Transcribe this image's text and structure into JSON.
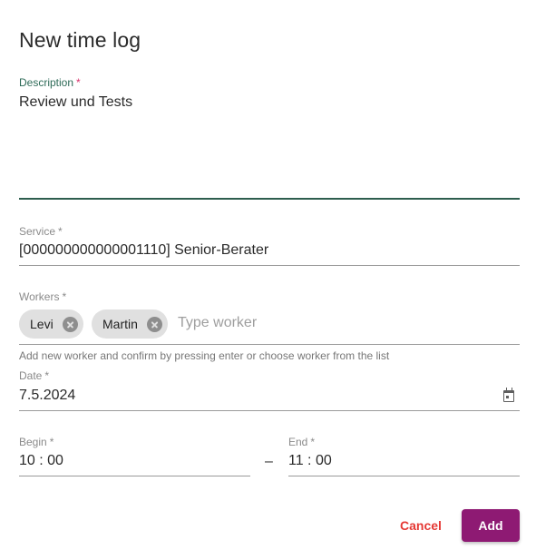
{
  "dialog": {
    "title": "New time log"
  },
  "description": {
    "label": "Description",
    "required_mark": "*",
    "value": "Review und Tests"
  },
  "service": {
    "label": "Service",
    "required_mark": "*",
    "value": "[000000000000001110] Senior-Berater"
  },
  "workers": {
    "label": "Workers",
    "required_mark": "*",
    "chips": [
      {
        "label": "Levi",
        "remove_icon": "cancel-circle-icon"
      },
      {
        "label": "Martin",
        "remove_icon": "cancel-circle-icon"
      }
    ],
    "input_placeholder": "Type worker",
    "hint": "Add new worker and confirm by pressing enter or choose worker from the list"
  },
  "date": {
    "label": "Date",
    "required_mark": "*",
    "value": "7.5.2024",
    "icon": "calendar-icon"
  },
  "time": {
    "begin_label": "Begin",
    "begin_required_mark": "*",
    "begin_value": "10 : 00",
    "separator": "–",
    "end_label": "End",
    "end_required_mark": "*",
    "end_value": "11 : 00"
  },
  "actions": {
    "cancel_label": "Cancel",
    "add_label": "Add"
  },
  "colors": {
    "accent": "#8e1a73",
    "focus": "#2e5e4e",
    "cancel": "#e53935",
    "required_active": "#d6336c"
  }
}
